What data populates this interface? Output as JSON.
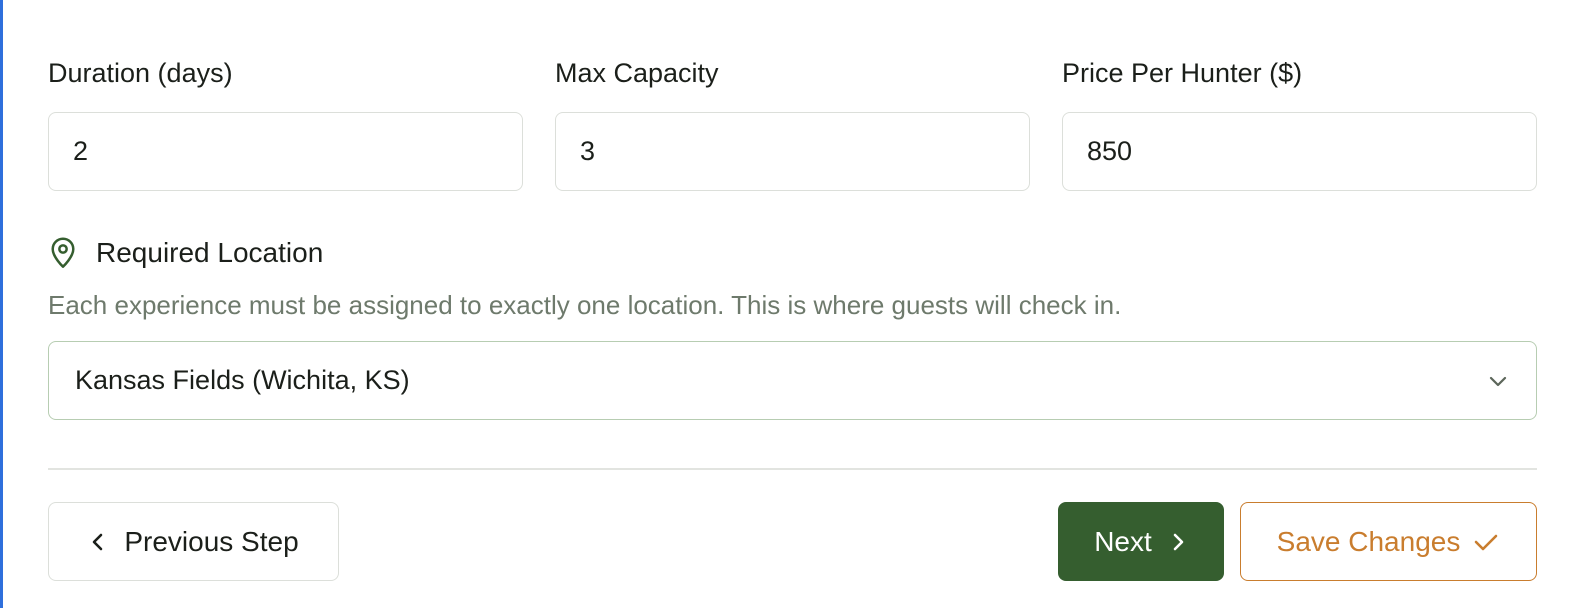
{
  "fields": [
    {
      "label": "Duration (days)",
      "value": "2"
    },
    {
      "label": "Max Capacity",
      "value": "3"
    },
    {
      "label": "Price Per Hunter ($)",
      "value": "850"
    }
  ],
  "location": {
    "title": "Required Location",
    "description": "Each experience must be assigned to exactly one location. This is where guests will check in.",
    "selected": "Kansas Fields (Wichita, KS)",
    "icon": "map-pin-icon"
  },
  "actions": {
    "previous_label": "Previous Step",
    "next_label": "Next",
    "save_label": "Save Changes"
  },
  "colors": {
    "primary_green": "#355e2f",
    "accent_orange": "#c97d2e",
    "muted_text": "#6e7a6c",
    "left_accent": "#2f6fdc"
  }
}
